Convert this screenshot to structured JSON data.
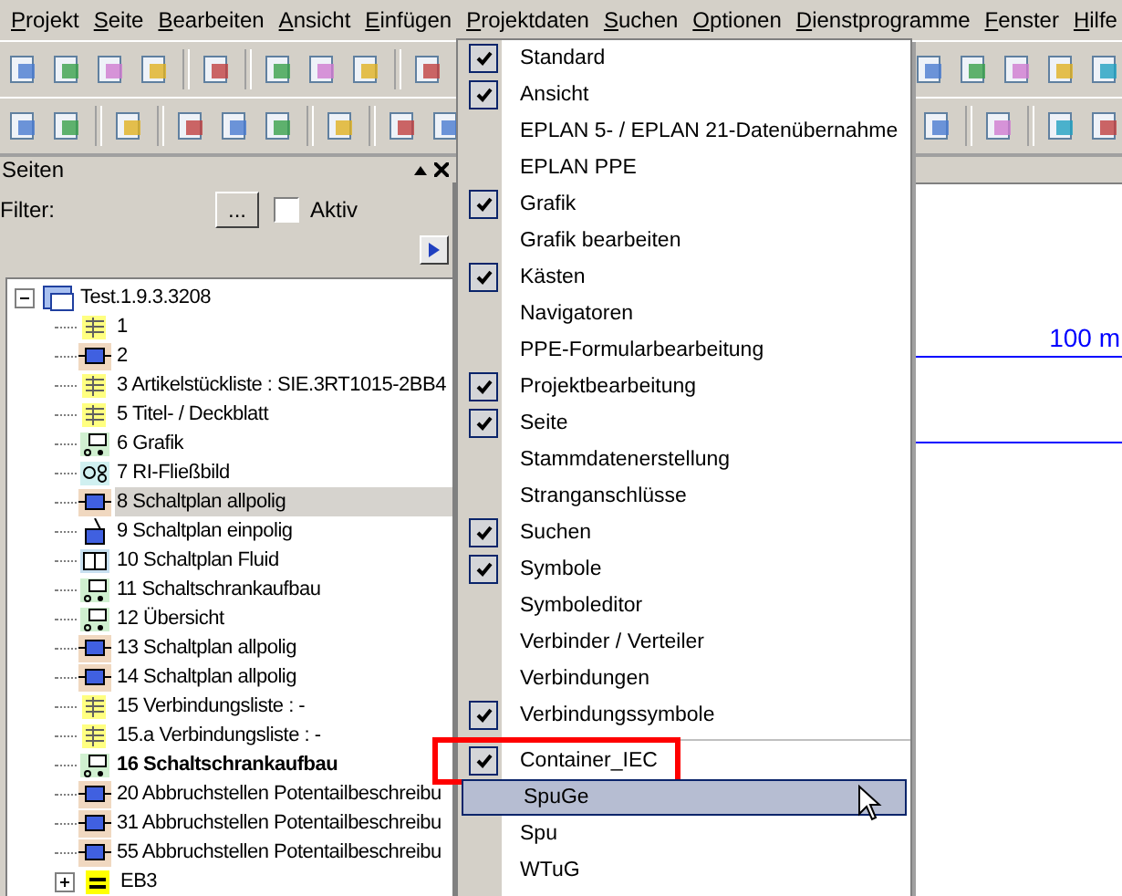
{
  "menubar": {
    "items": [
      {
        "label": "Projekt",
        "open": false
      },
      {
        "label": "Seite",
        "open": false
      },
      {
        "label": "Bearbeiten",
        "open": false
      },
      {
        "label": "Ansicht",
        "open": false
      },
      {
        "label": "Einfügen",
        "open": false
      },
      {
        "label": "Projektdaten",
        "open": false
      },
      {
        "label": "Suchen",
        "open": false
      },
      {
        "label": "Optionen",
        "open": false
      },
      {
        "label": "Dienstprogramme",
        "open": false
      },
      {
        "label": "Fenster",
        "open": false
      },
      {
        "label": "Hilfe",
        "open": false
      }
    ]
  },
  "pages_panel": {
    "title": "Seiten",
    "filter_label": "Filter:",
    "filter_button": "...",
    "active_checkbox": {
      "label": "Aktiv",
      "checked": false
    },
    "tree": [
      {
        "label": "Test.1.9.3.3208",
        "kind": "project",
        "expanded": true,
        "selected": false,
        "bold": false,
        "children": [
          {
            "label": "1",
            "kind": "form",
            "selected": false,
            "bold": false
          },
          {
            "label": "2",
            "kind": "schematic",
            "selected": false,
            "bold": false
          },
          {
            "label": "3 Artikelstückliste : SIE.3RT1015-2BB4",
            "kind": "list",
            "selected": false,
            "bold": false
          },
          {
            "label": "5 Titel- / Deckblatt",
            "kind": "form",
            "selected": false,
            "bold": false
          },
          {
            "label": "6 Grafik",
            "kind": "graphic",
            "selected": false,
            "bold": false
          },
          {
            "label": "7 RI-Fließbild",
            "kind": "pid",
            "selected": false,
            "bold": false
          },
          {
            "label": "8 Schaltplan allpolig",
            "kind": "schematic",
            "selected": true,
            "bold": false
          },
          {
            "label": "9 Schaltplan einpolig",
            "kind": "singleline",
            "selected": false,
            "bold": false
          },
          {
            "label": "10 Schaltplan Fluid",
            "kind": "fluid",
            "selected": false,
            "bold": false
          },
          {
            "label": "11 Schaltschrankaufbau",
            "kind": "graphic",
            "selected": false,
            "bold": false
          },
          {
            "label": "12 Übersicht",
            "kind": "graphic",
            "selected": false,
            "bold": false
          },
          {
            "label": "13 Schaltplan allpolig",
            "kind": "schematic",
            "selected": false,
            "bold": false
          },
          {
            "label": "14 Schaltplan allpolig",
            "kind": "schematic",
            "selected": false,
            "bold": false
          },
          {
            "label": "15 Verbindungsliste :  -",
            "kind": "list",
            "selected": false,
            "bold": false
          },
          {
            "label": "15.a Verbindungsliste :  -",
            "kind": "list",
            "selected": false,
            "bold": false
          },
          {
            "label": "16 Schaltschrankaufbau",
            "kind": "graphic",
            "selected": false,
            "bold": true
          },
          {
            "label": "20 Abbruchstellen Potentailbeschreibu",
            "kind": "schematic",
            "selected": false,
            "bold": false
          },
          {
            "label": "31 Abbruchstellen Potentailbeschreibu",
            "kind": "schematic",
            "selected": false,
            "bold": false
          },
          {
            "label": "55 Abbruchstellen Potentailbeschreibu",
            "kind": "schematic",
            "selected": false,
            "bold": false
          },
          {
            "label": "EB3",
            "kind": "group",
            "expanded": false,
            "selected": false,
            "bold": false
          }
        ]
      }
    ]
  },
  "canvas": {
    "dimension_label": "100 m"
  },
  "toolbar_menu": {
    "items": [
      {
        "label": "Standard",
        "checked": true,
        "selected": false,
        "highlighted": false
      },
      {
        "label": "Ansicht",
        "checked": true,
        "selected": false,
        "highlighted": false
      },
      {
        "label": "EPLAN 5- / EPLAN 21-Datenübernahme",
        "checked": false,
        "selected": false,
        "highlighted": false
      },
      {
        "label": "EPLAN PPE",
        "checked": false,
        "selected": false,
        "highlighted": false
      },
      {
        "label": "Grafik",
        "checked": true,
        "selected": false,
        "highlighted": false
      },
      {
        "label": "Grafik bearbeiten",
        "checked": false,
        "selected": false,
        "highlighted": false
      },
      {
        "label": "Kästen",
        "checked": true,
        "selected": false,
        "highlighted": false
      },
      {
        "label": "Navigatoren",
        "checked": false,
        "selected": false,
        "highlighted": false
      },
      {
        "label": "PPE-Formularbearbeitung",
        "checked": false,
        "selected": false,
        "highlighted": false
      },
      {
        "label": "Projektbearbeitung",
        "checked": true,
        "selected": false,
        "highlighted": false
      },
      {
        "label": "Seite",
        "checked": true,
        "selected": false,
        "highlighted": false
      },
      {
        "label": "Stammdatenerstellung",
        "checked": false,
        "selected": false,
        "highlighted": false
      },
      {
        "label": "Stranganschlüsse",
        "checked": false,
        "selected": false,
        "highlighted": false
      },
      {
        "label": "Suchen",
        "checked": true,
        "selected": false,
        "highlighted": false
      },
      {
        "label": "Symbole",
        "checked": true,
        "selected": false,
        "highlighted": false
      },
      {
        "label": "Symboleditor",
        "checked": false,
        "selected": false,
        "highlighted": false
      },
      {
        "label": "Verbinder / Verteiler",
        "checked": false,
        "selected": false,
        "highlighted": false
      },
      {
        "label": "Verbindungen",
        "checked": false,
        "selected": false,
        "highlighted": false
      },
      {
        "label": "Verbindungssymbole",
        "checked": true,
        "selected": false,
        "highlighted": false
      },
      {
        "kind": "separator"
      },
      {
        "label": "Container_IEC",
        "checked": true,
        "selected": false,
        "highlighted": true
      },
      {
        "label": "SpuGe",
        "checked": false,
        "selected": true,
        "highlighted": false
      },
      {
        "label": "Spu",
        "checked": false,
        "selected": false,
        "highlighted": false
      },
      {
        "label": "WTuG",
        "checked": false,
        "selected": false,
        "highlighted": false
      }
    ]
  }
}
